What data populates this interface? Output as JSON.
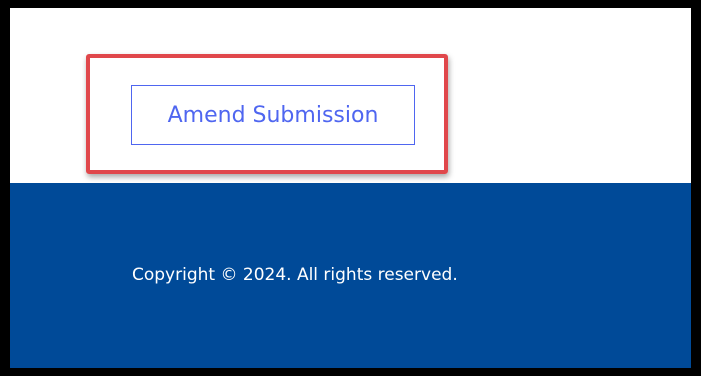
{
  "main": {
    "amend_button_label": "Amend Submission"
  },
  "footer": {
    "copyright_text": "Copyright © 2024. All rights reserved."
  },
  "colors": {
    "button_accent": "#4f66f0",
    "highlight_border": "#e0474b",
    "footer_background": "#004a98",
    "footer_text": "#ffffff"
  }
}
